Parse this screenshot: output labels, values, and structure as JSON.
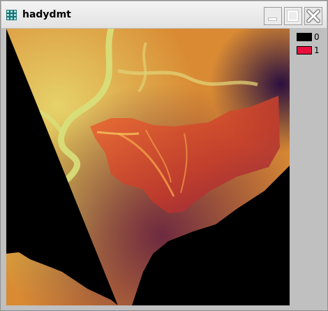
{
  "window": {
    "title": "hadydmt",
    "title_icon": "grid-icon"
  },
  "controls": {
    "minimize_icon": "minimize-icon",
    "maximize_icon": "maximize-icon",
    "close_icon": "close-icon"
  },
  "colors": {
    "title_bar": "#eeeeee",
    "panel": "#c0c0c0",
    "class_0": "#000000",
    "class_1": "#e8103c",
    "elevation_high": "#c8d46a",
    "elevation_mid": "#e08a2a",
    "elevation_low": "#6a2a3a"
  },
  "legend": {
    "items": [
      {
        "label": "0",
        "color": "#000000"
      },
      {
        "label": "1",
        "color": "#e8103c"
      }
    ]
  }
}
